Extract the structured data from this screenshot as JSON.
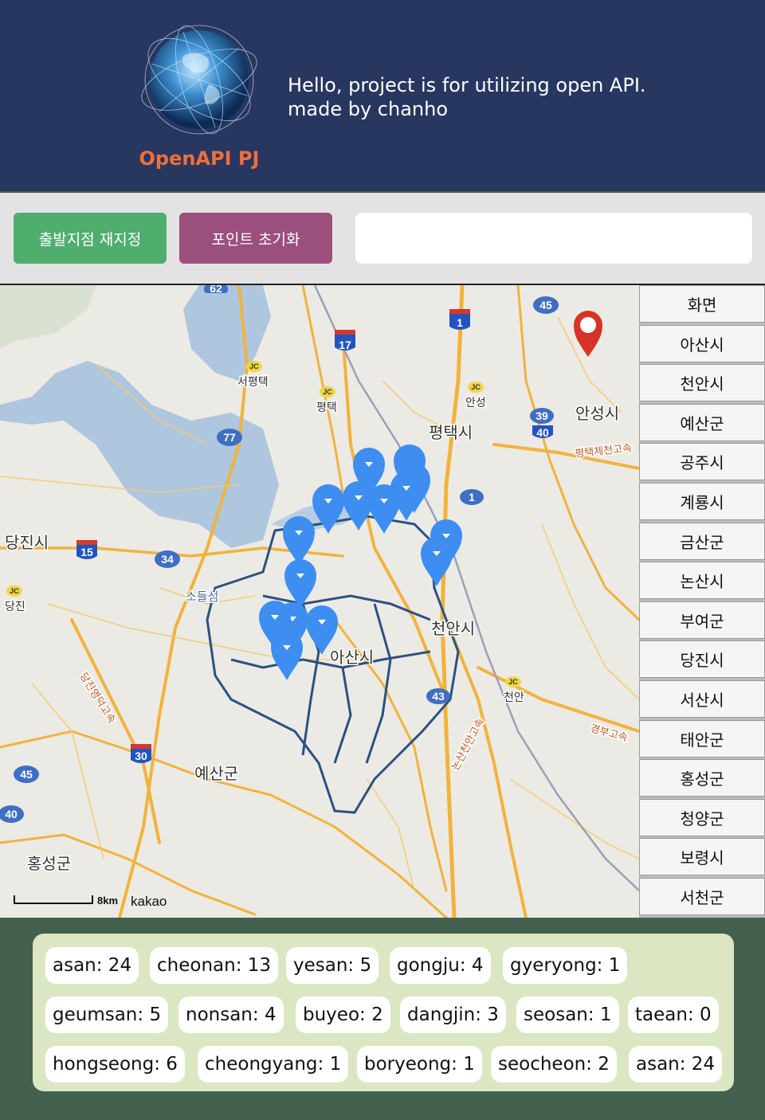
{
  "header": {
    "logo_text": "OpenAPI PJ",
    "intro_line1": "Hello, project is for utilizing open API.",
    "intro_line2": "made by chanho"
  },
  "toolbar": {
    "reset_start_label": "출발지점 재지정",
    "reset_points_label": "포인트 초기화",
    "search_value": ""
  },
  "map": {
    "labels": {
      "pyeongtaek_city": "평택시",
      "anseong_city": "안성시",
      "dangjin_city": "당진시",
      "cheonan_city": "천안시",
      "asan_city": "아산시",
      "yesan_county": "예산군",
      "hongseong_county": "홍성군",
      "seopyeongtaek": "서평택",
      "pyeongtaek": "평택",
      "anseong": "안성",
      "cheonan": "천안",
      "dangjin": "당진",
      "soreulseom": "소들섬",
      "road_pyeongtaek_jecheon": "평택제천고속",
      "road_gyeongbu": "경부고속",
      "road_nonsan_cheonan": "논산천안고속",
      "road_dangjin_yeongdeok": "당진영덕고속",
      "route_62": "62",
      "route_17": "17",
      "route_1": "1",
      "route_45": "45",
      "route_39": "39",
      "route_40": "40",
      "route_77": "77",
      "route_15": "15",
      "route_34": "34",
      "route_30": "30",
      "route_43": "43",
      "route_45b": "45",
      "route_40b": "40",
      "route_1b": "1",
      "jc": "JC"
    },
    "scale_label": "8km",
    "brand": "kakao"
  },
  "regions": [
    "화면",
    "아산시",
    "천안시",
    "예산군",
    "공주시",
    "계룡시",
    "금산군",
    "논산시",
    "부여군",
    "당진시",
    "서산시",
    "태안군",
    "홍성군",
    "청양군",
    "보령시",
    "서천군"
  ],
  "stats": [
    "asan: 24",
    "cheonan: 13",
    "yesan: 5",
    "gongju: 4",
    "gyeryong: 1",
    "geumsan: 5",
    "nonsan: 4",
    "buyeo: 2",
    "dangjin: 3",
    "seosan: 1",
    "taean: 0",
    "hongseong: 6",
    "cheongyang: 1",
    "boryeong: 1",
    "seocheon: 2",
    "asan: 24"
  ],
  "colors": {
    "header_bg": "#273760",
    "logo_text": "#ef6f3a",
    "btn_green": "#4fae6e",
    "btn_purple": "#9b4f7c",
    "marker_blue": "#3d8ef0",
    "marker_red": "#d63426",
    "stats_panel": "#dbe6c2",
    "footer_bg": "#44604f"
  },
  "icons": {
    "logo": "globe-icon",
    "marker": "map-pin-icon",
    "start_marker": "red-pin-icon"
  }
}
